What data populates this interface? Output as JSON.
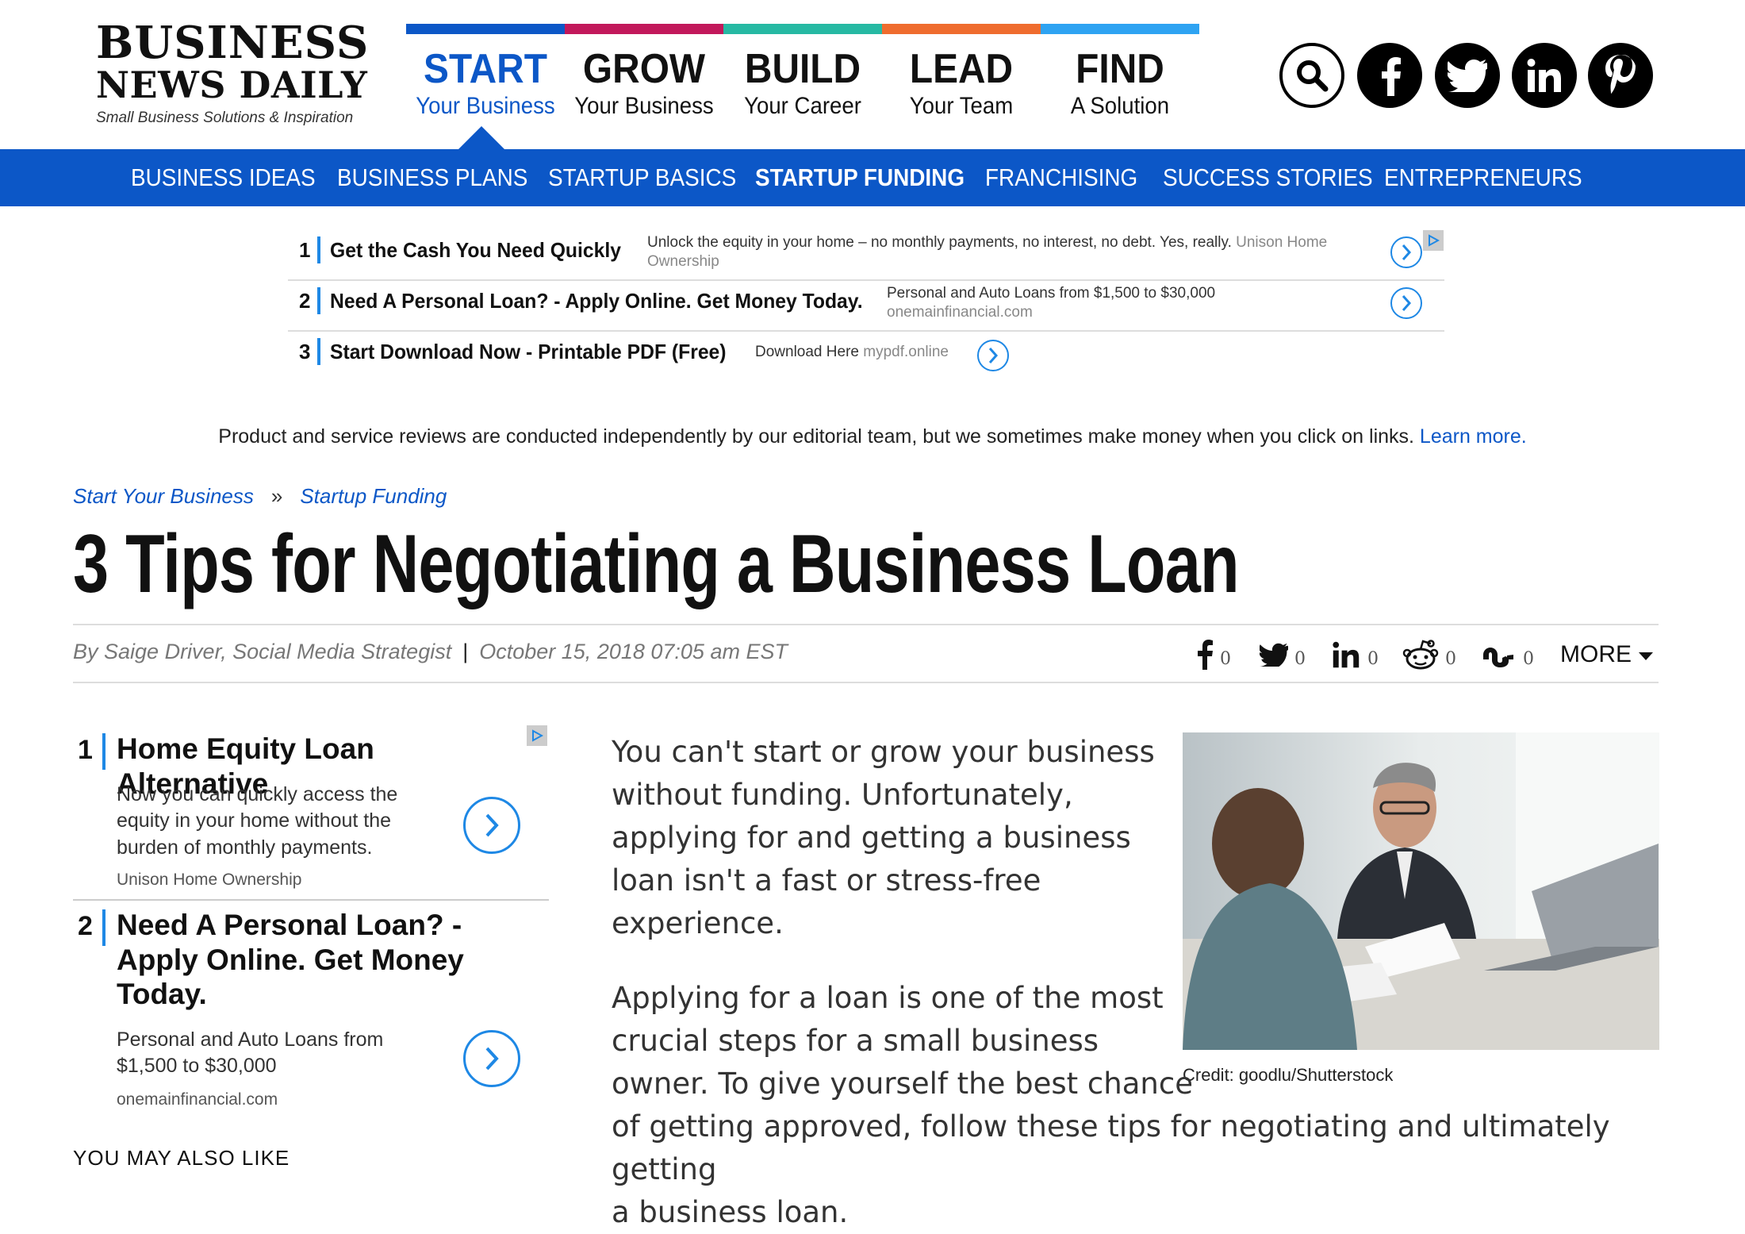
{
  "logo": {
    "line1": "BUSINESS",
    "line2": "NEWS DAILY",
    "tagline": "Small Business Solutions & Inspiration"
  },
  "topnav": {
    "colors": [
      "#0c57c7",
      "#c2185b",
      "#26b9a3",
      "#ef6c2e",
      "#2ea3f2"
    ],
    "items": [
      {
        "big": "START",
        "small": "Your Business"
      },
      {
        "big": "GROW",
        "small": "Your Business"
      },
      {
        "big": "BUILD",
        "small": "Your Career"
      },
      {
        "big": "LEAD",
        "small": "Your Team"
      },
      {
        "big": "FIND",
        "small": "A Solution"
      }
    ],
    "active_index": 0
  },
  "social_icons": [
    "search-icon",
    "facebook-icon",
    "twitter-icon",
    "linkedin-icon",
    "pinterest-icon"
  ],
  "subnav": {
    "items": [
      "BUSINESS IDEAS",
      "BUSINESS PLANS",
      "STARTUP BASICS",
      "STARTUP FUNDING",
      "FRANCHISING",
      "SUCCESS STORIES",
      "ENTREPRENEURS"
    ],
    "active": "STARTUP FUNDING"
  },
  "top_ad": [
    {
      "num": "1",
      "headline": "Get the Cash You Need Quickly",
      "desc": "Unlock the equity in your home – no monthly payments, no interest, no debt. Yes, really.",
      "source": "Unison Home Ownership"
    },
    {
      "num": "2",
      "headline": "Need A Personal Loan? - Apply Online. Get Money Today.",
      "desc": "Personal and Auto Loans from $1,500 to $30,000",
      "source": "onemainfinancial.com"
    },
    {
      "num": "3",
      "headline": "Start Download Now - Printable PDF (Free)",
      "desc": "Download Here",
      "source": "mypdf.online"
    }
  ],
  "disclaimer": {
    "text": "Product and service reviews are conducted independently by our editorial team, but we sometimes make money when you click on links.",
    "link": "Learn more."
  },
  "breadcrumb": {
    "first": "Start Your Business",
    "sep": "»",
    "second": "Startup Funding"
  },
  "article": {
    "title": "3 Tips for Negotiating a Business Loan",
    "author": "By Saige Driver, Social Media Strategist",
    "date": "October 15, 2018 07:05 am EST",
    "p1": "You can't start or grow your business without funding. Unfortunately, applying for and getting a business loan isn't a fast or stress-free experience.",
    "p2_lines": [
      "Applying for a loan is one of the most",
      "crucial steps for a small business",
      "owner. To give yourself the best chance",
      "of getting approved, follow these tips for negotiating and ultimately getting",
      "a business loan."
    ],
    "image_credit": "Credit: goodlu/Shutterstock"
  },
  "share": {
    "counts": [
      "0",
      "0",
      "0",
      "0",
      "0"
    ],
    "icons": [
      "facebook-icon",
      "twitter-icon",
      "linkedin-icon",
      "reddit-icon",
      "stumbleupon-icon"
    ],
    "more_label": "MORE"
  },
  "side_ad": [
    {
      "num": "1",
      "headline": "Home Equity Loan Alternative",
      "desc": "Now you can quickly access the equity in your home without the burden of monthly payments.",
      "source": "Unison Home Ownership"
    },
    {
      "num": "2",
      "headline": "Need A Personal Loan? - Apply Online. Get Money Today.",
      "desc": "Personal and Auto Loans from $1,500 to $30,000",
      "source": "onemainfinancial.com"
    }
  ],
  "also_like": "YOU MAY ALSO LIKE"
}
